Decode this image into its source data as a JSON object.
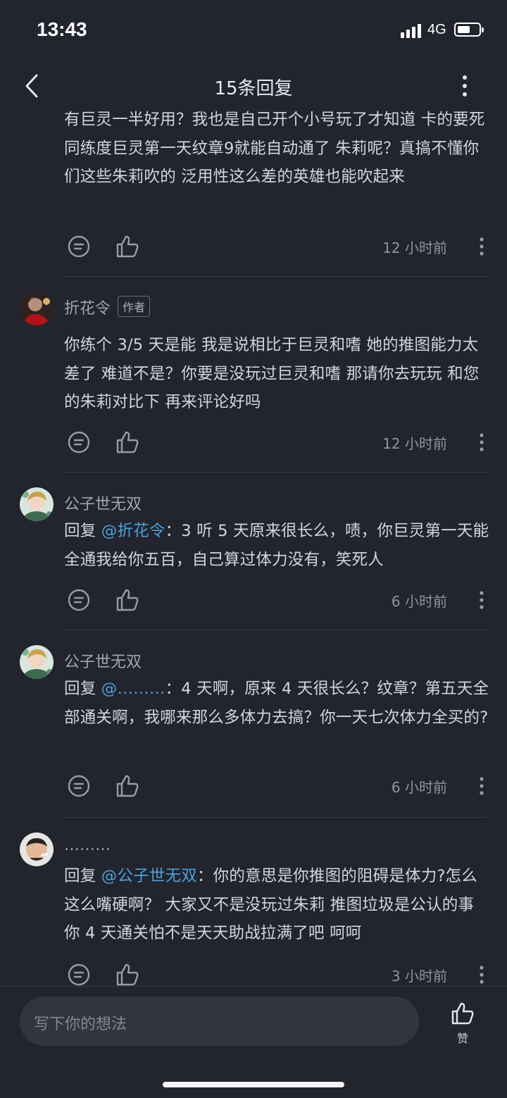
{
  "status": {
    "time": "13:43",
    "network": "4G"
  },
  "nav": {
    "title": "15条回复"
  },
  "comments": [
    {
      "text": "有巨灵一半好用？我也是自己开个小号玩了才知道 卡的要死 同练度巨灵第一天纹章9就能自动通了 朱莉呢？真搞不懂你们这些朱莉吹的 泛用性这么差的英雄也能吹起来",
      "time": "12 小时前"
    },
    {
      "author": "折花令",
      "badge": "作者",
      "text": "你练个 3/5 天是能  我是说相比于巨灵和嗜  她的推图能力太差了  难道不是？你要是没玩过巨灵和嗜  那请你去玩玩  和您的朱莉对比下  再来评论好吗",
      "time": "12 小时前"
    },
    {
      "author": "公子世无双",
      "reply_prefix": "回复 ",
      "mention": "@折花令",
      "text": "：3 听 5 天原来很长么，啧，你巨灵第一天能全通我给你五百，自己算过体力没有，笑死人",
      "time": "6 小时前"
    },
    {
      "author": "公子世无双",
      "reply_prefix": "回复 ",
      "mention": "@………",
      "text": "：4 天啊，原来 4 天很长么？纹章？第五天全部通关啊，我哪来那么多体力去搞？你一天七次体力全买的?",
      "time": "6 小时前"
    },
    {
      "author": "………",
      "reply_prefix": "回复 ",
      "mention": "@公子世无双",
      "text": "：你的意思是你推图的阻碍是体力?怎么这么嘴硬啊？ 大家又不是没玩过朱莉 推图垃圾是公认的事 你 4 天通关怕不是天天助战拉满了吧 呵呵",
      "time": "3 小时前"
    }
  ],
  "bottom": {
    "input_placeholder": "写下你的想法",
    "like_label": "赞"
  },
  "icons": [
    "chevron-left-icon",
    "more-vertical-icon",
    "comment-icon",
    "thumbs-up-icon",
    "more-icon"
  ],
  "colors": {
    "background": "#22242e",
    "mention": "#4fa0da",
    "input_bg": "#32343f"
  }
}
